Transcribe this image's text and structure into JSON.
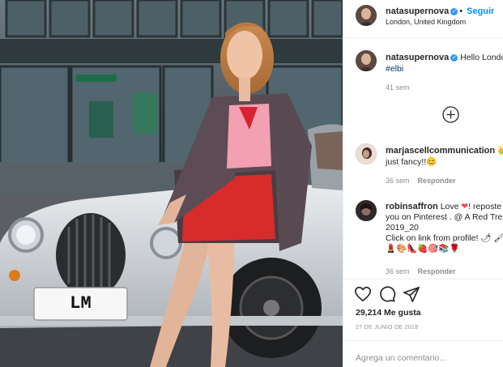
{
  "post": {
    "username": "natasupernova",
    "follow_label": "Seguir",
    "location": "London, United Kingdom",
    "caption_text": "Hello London",
    "caption_hashtag": "#elbi",
    "caption_time": "41 sem",
    "likes": "29,214 Me gusta",
    "date": "27 DE JUNIO DE 2019",
    "add_comment_placeholder": "Agrega un comentario..."
  },
  "comments": [
    {
      "username": "marjascellcommunication",
      "text_line1_suffix": "",
      "emoji_line1": "👑",
      "text_line2": "just fancy!!😊",
      "time": "36 sem",
      "reply_label": "Responder"
    },
    {
      "username": "robinsaffron",
      "text_line1a": "Love",
      "emoji_heart": "❤",
      "text_line1b": "! reposte",
      "text_line2": "you on Pinterest . @ A Red Tre",
      "text_line3": "2019_20",
      "text_line4": "Click on link from profile! 🌶 🖌",
      "text_line5": "💄🎨👠🍓🎯📚🌹",
      "time": "36 sem",
      "reply_label": "Responder"
    }
  ],
  "photo": {
    "plate": "LM"
  },
  "colors": {
    "link_blue": "#0095f6",
    "verified_blue": "#3897f0",
    "secondary_text": "#8e8e8e",
    "heart_red": "#ed4956"
  },
  "icons": [
    "verified-icon",
    "load-more-plus-icon",
    "heart-icon",
    "comment-icon",
    "share-icon"
  ]
}
